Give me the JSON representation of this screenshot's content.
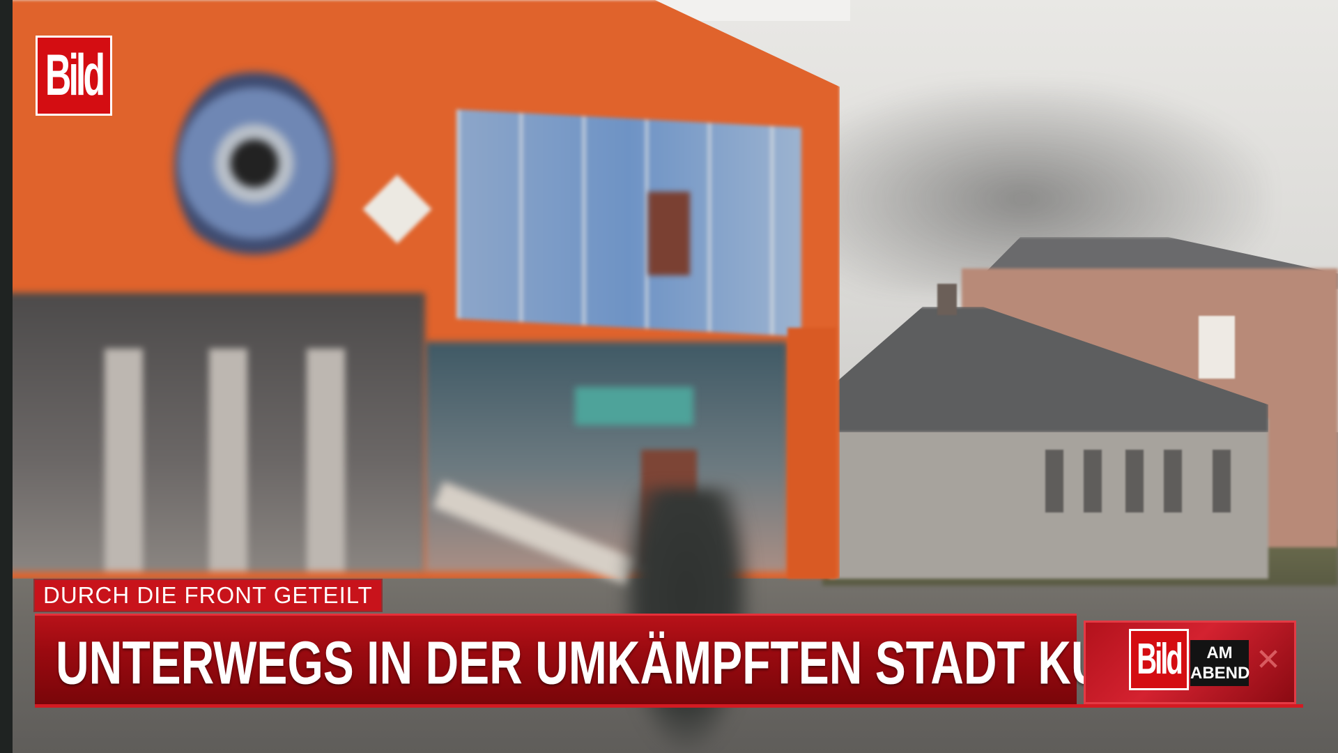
{
  "logo": {
    "text": "Bild"
  },
  "lower_third": {
    "kicker": "DURCH DIE FRONT GETEILT",
    "headline": "UNTERWEGS IN DER UMKÄMPFTEN STADT KUPJANSK"
  },
  "show_badge": {
    "logo_text": "Bild",
    "line1": "AM",
    "line2": "ABEND"
  },
  "colors": {
    "brand_red": "#d40d12",
    "bar_red": "#9a0a10",
    "building_orange": "#e0632c"
  }
}
